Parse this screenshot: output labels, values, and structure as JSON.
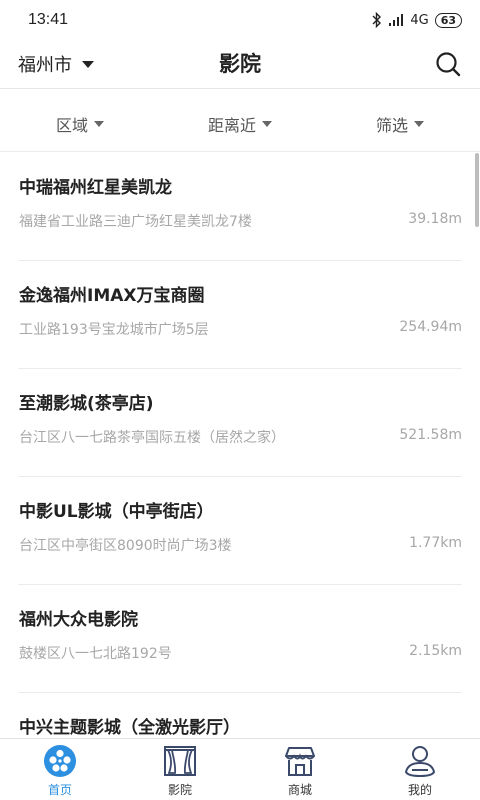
{
  "status": {
    "time": "13:41",
    "network": "4G",
    "battery": "63"
  },
  "header": {
    "city": "福州市",
    "title": "影院"
  },
  "filters": [
    {
      "label": "区域"
    },
    {
      "label": "距离近"
    },
    {
      "label": "筛选"
    }
  ],
  "cinemas": [
    {
      "name": "中瑞福州红星美凯龙",
      "address": "福建省工业路三迪广场红星美凯龙7楼",
      "distance": "39.18m"
    },
    {
      "name": "金逸福州IMAX万宝商圈",
      "address": "工业路193号宝龙城市广场5层",
      "distance": "254.94m"
    },
    {
      "name": "至潮影城(茶亭店)",
      "address": "台江区八一七路茶亭国际五楼（居然之家）",
      "distance": "521.58m"
    },
    {
      "name": "中影UL影城（中亭街店）",
      "address": "台江区中亭街区8090时尚广场3楼",
      "distance": "1.77km"
    },
    {
      "name": "福州大众电影院",
      "address": "鼓楼区八一七北路192号",
      "distance": "2.15km"
    },
    {
      "name": "中兴主题影城（全激光影厅）",
      "address": "",
      "distance": ""
    }
  ],
  "tabs": [
    {
      "label": "首页",
      "icon": "film-reel-icon"
    },
    {
      "label": "影院",
      "icon": "cinema-curtain-icon"
    },
    {
      "label": "商城",
      "icon": "shop-icon"
    },
    {
      "label": "我的",
      "icon": "user-icon"
    }
  ],
  "colors": {
    "accent": "#2d8fe0",
    "text": "#222222",
    "muted": "#a7a7a7"
  }
}
